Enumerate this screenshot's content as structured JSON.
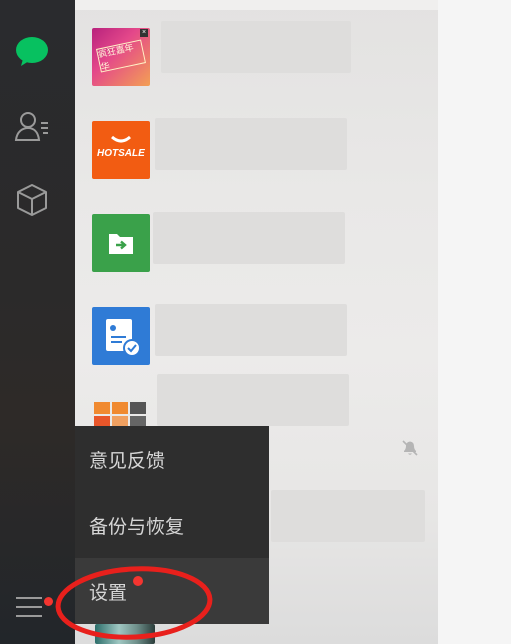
{
  "nav": {
    "items": [
      {
        "name": "chat",
        "icon": "chat-bubble-icon",
        "active": true,
        "color": "#07c160"
      },
      {
        "name": "contacts",
        "icon": "contacts-icon",
        "active": false
      },
      {
        "name": "mini-programs",
        "icon": "cube-icon",
        "active": false
      }
    ],
    "menu_icon": "hamburger-icon",
    "accent": "#07c160"
  },
  "chat_list": {
    "items": [
      {
        "avatar": "promo-banner-avatar",
        "avatar_caption": "疯狂嘉年华"
      },
      {
        "avatar": "hotsale-logo-avatar",
        "avatar_caption": "HOTSALE"
      },
      {
        "avatar": "file-transfer-avatar"
      },
      {
        "avatar": "document-check-avatar"
      },
      {
        "avatar": "product-grid-avatar",
        "muted": true
      },
      {
        "avatar": "extra-chat-avatar"
      }
    ]
  },
  "menu": {
    "items": [
      {
        "label": "意见反馈"
      },
      {
        "label": "备份与恢复"
      },
      {
        "label": "设置",
        "highlighted": true
      }
    ],
    "annotation_color": "#e8201c",
    "badge_color": "#f43530"
  }
}
